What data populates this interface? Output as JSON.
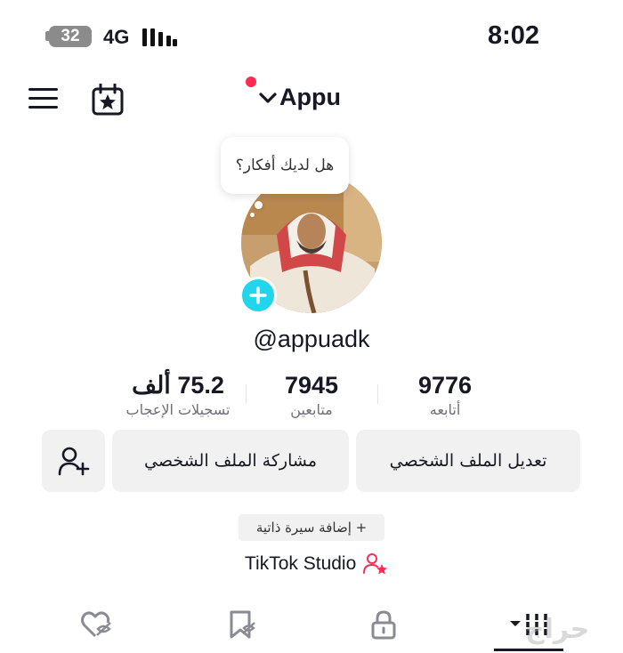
{
  "status_bar": {
    "battery": "32",
    "network": "4G",
    "time": "8:02"
  },
  "header": {
    "account_name": "Appu"
  },
  "profile": {
    "bubble_text": "هل لديك أفكار؟",
    "handle": "@appuadk"
  },
  "stats": [
    {
      "value": "9776",
      "label": "أتابعه"
    },
    {
      "value": "7945",
      "label": "متابعين"
    },
    {
      "value": "75.2 ألف",
      "label": "تسجيلات الإعجاب"
    }
  ],
  "buttons": {
    "edit_profile": "تعديل الملف الشخصي",
    "share_profile": "مشاركة الملف الشخصي"
  },
  "bio": {
    "add_label": "+ إضافة سيرة ذاتية"
  },
  "studio": {
    "label": "TikTok Studio"
  },
  "tabs": [
    "grid-videos",
    "private-lock",
    "reposts",
    "liked"
  ],
  "watermark": "حراج",
  "colors": {
    "accent_red": "#fe2c55",
    "add_cyan": "#20d5ec",
    "button_bg": "#f1f1f2"
  }
}
